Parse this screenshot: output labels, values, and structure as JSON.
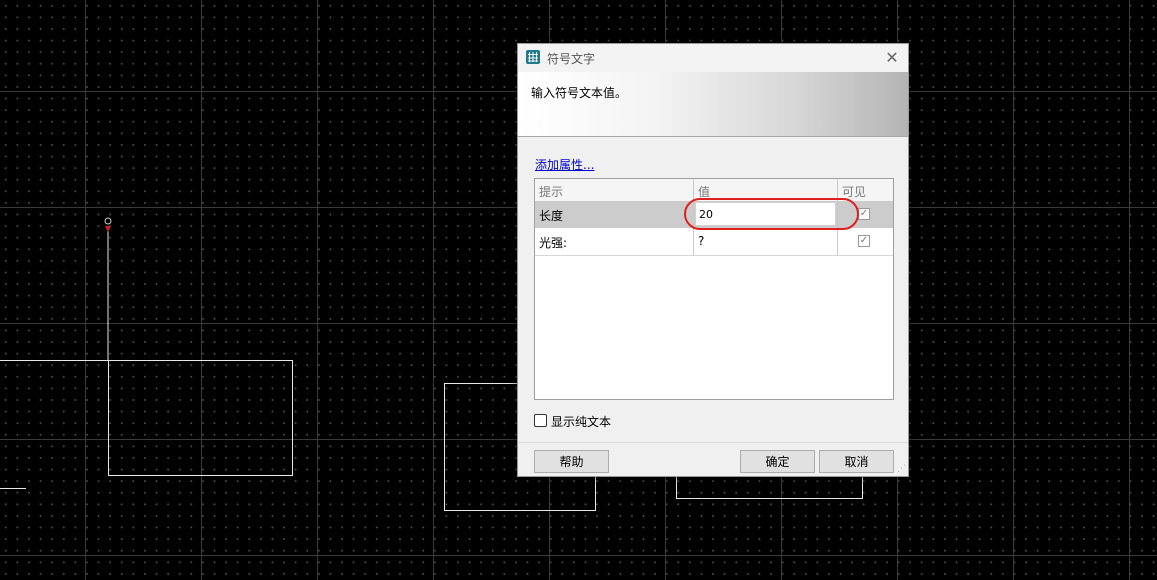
{
  "dialog": {
    "title": "符号文字",
    "header_text": "输入符号文本值。",
    "add_attribute_link": "添加属性...",
    "columns": {
      "prompt": "提示",
      "value": "值",
      "visible": "可见"
    },
    "rows": [
      {
        "prompt": "长度",
        "value": "20",
        "visible": true,
        "selected": true
      },
      {
        "prompt": "光强:",
        "value": "?",
        "visible": true,
        "selected": false
      }
    ],
    "plain_text_label": "显示纯文本",
    "plain_text_checked": false,
    "buttons": {
      "help": "帮助",
      "ok": "确定",
      "cancel": "取消"
    },
    "close_glyph": "✕",
    "check_glyph": "✓",
    "grip_glyph": "⋰"
  },
  "colors": {
    "canvas_background": "#000000",
    "highlight_ellipse": "#e0201e",
    "link": "#0000cc",
    "selected_row": "#cccccc",
    "app_icon": "#1f7a8c"
  },
  "icons": {
    "app": "grid-table-icon",
    "close": "close-icon",
    "check": "checkmark-icon",
    "resize": "resize-grip-icon"
  }
}
